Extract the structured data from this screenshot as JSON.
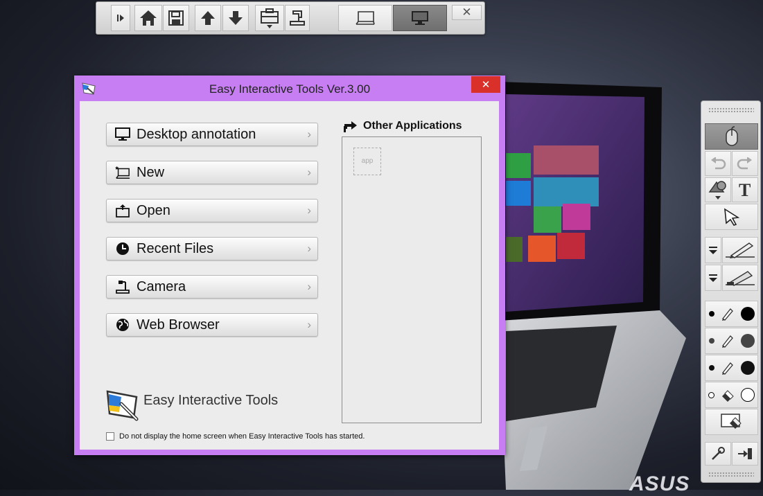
{
  "window": {
    "title": "Easy Interactive Tools Ver.3.00",
    "close_label": "✕"
  },
  "menu": {
    "items": [
      {
        "label": "Desktop annotation",
        "icon": "monitor-icon"
      },
      {
        "label": "New",
        "icon": "new-whiteboard-icon"
      },
      {
        "label": "Open",
        "icon": "open-folder-icon"
      },
      {
        "label": "Recent Files",
        "icon": "clock-icon"
      },
      {
        "label": "Camera",
        "icon": "document-camera-icon"
      },
      {
        "label": "Web Browser",
        "icon": "globe-icon"
      }
    ],
    "chevron": "›"
  },
  "other_apps": {
    "heading": "Other Applications",
    "slot_label": "app"
  },
  "logo": {
    "text": "Easy Interactive Tools"
  },
  "startup_option": {
    "label": "Do not display the home screen when Easy Interactive Tools has started.",
    "checked": false
  },
  "topbar": {
    "close_label": "✕"
  },
  "desktop": {
    "brand": "ASUS"
  },
  "colors": {
    "title_bar": "#c77ef3",
    "close_button": "#d9312a",
    "active_tool": "#7d7d7d"
  }
}
